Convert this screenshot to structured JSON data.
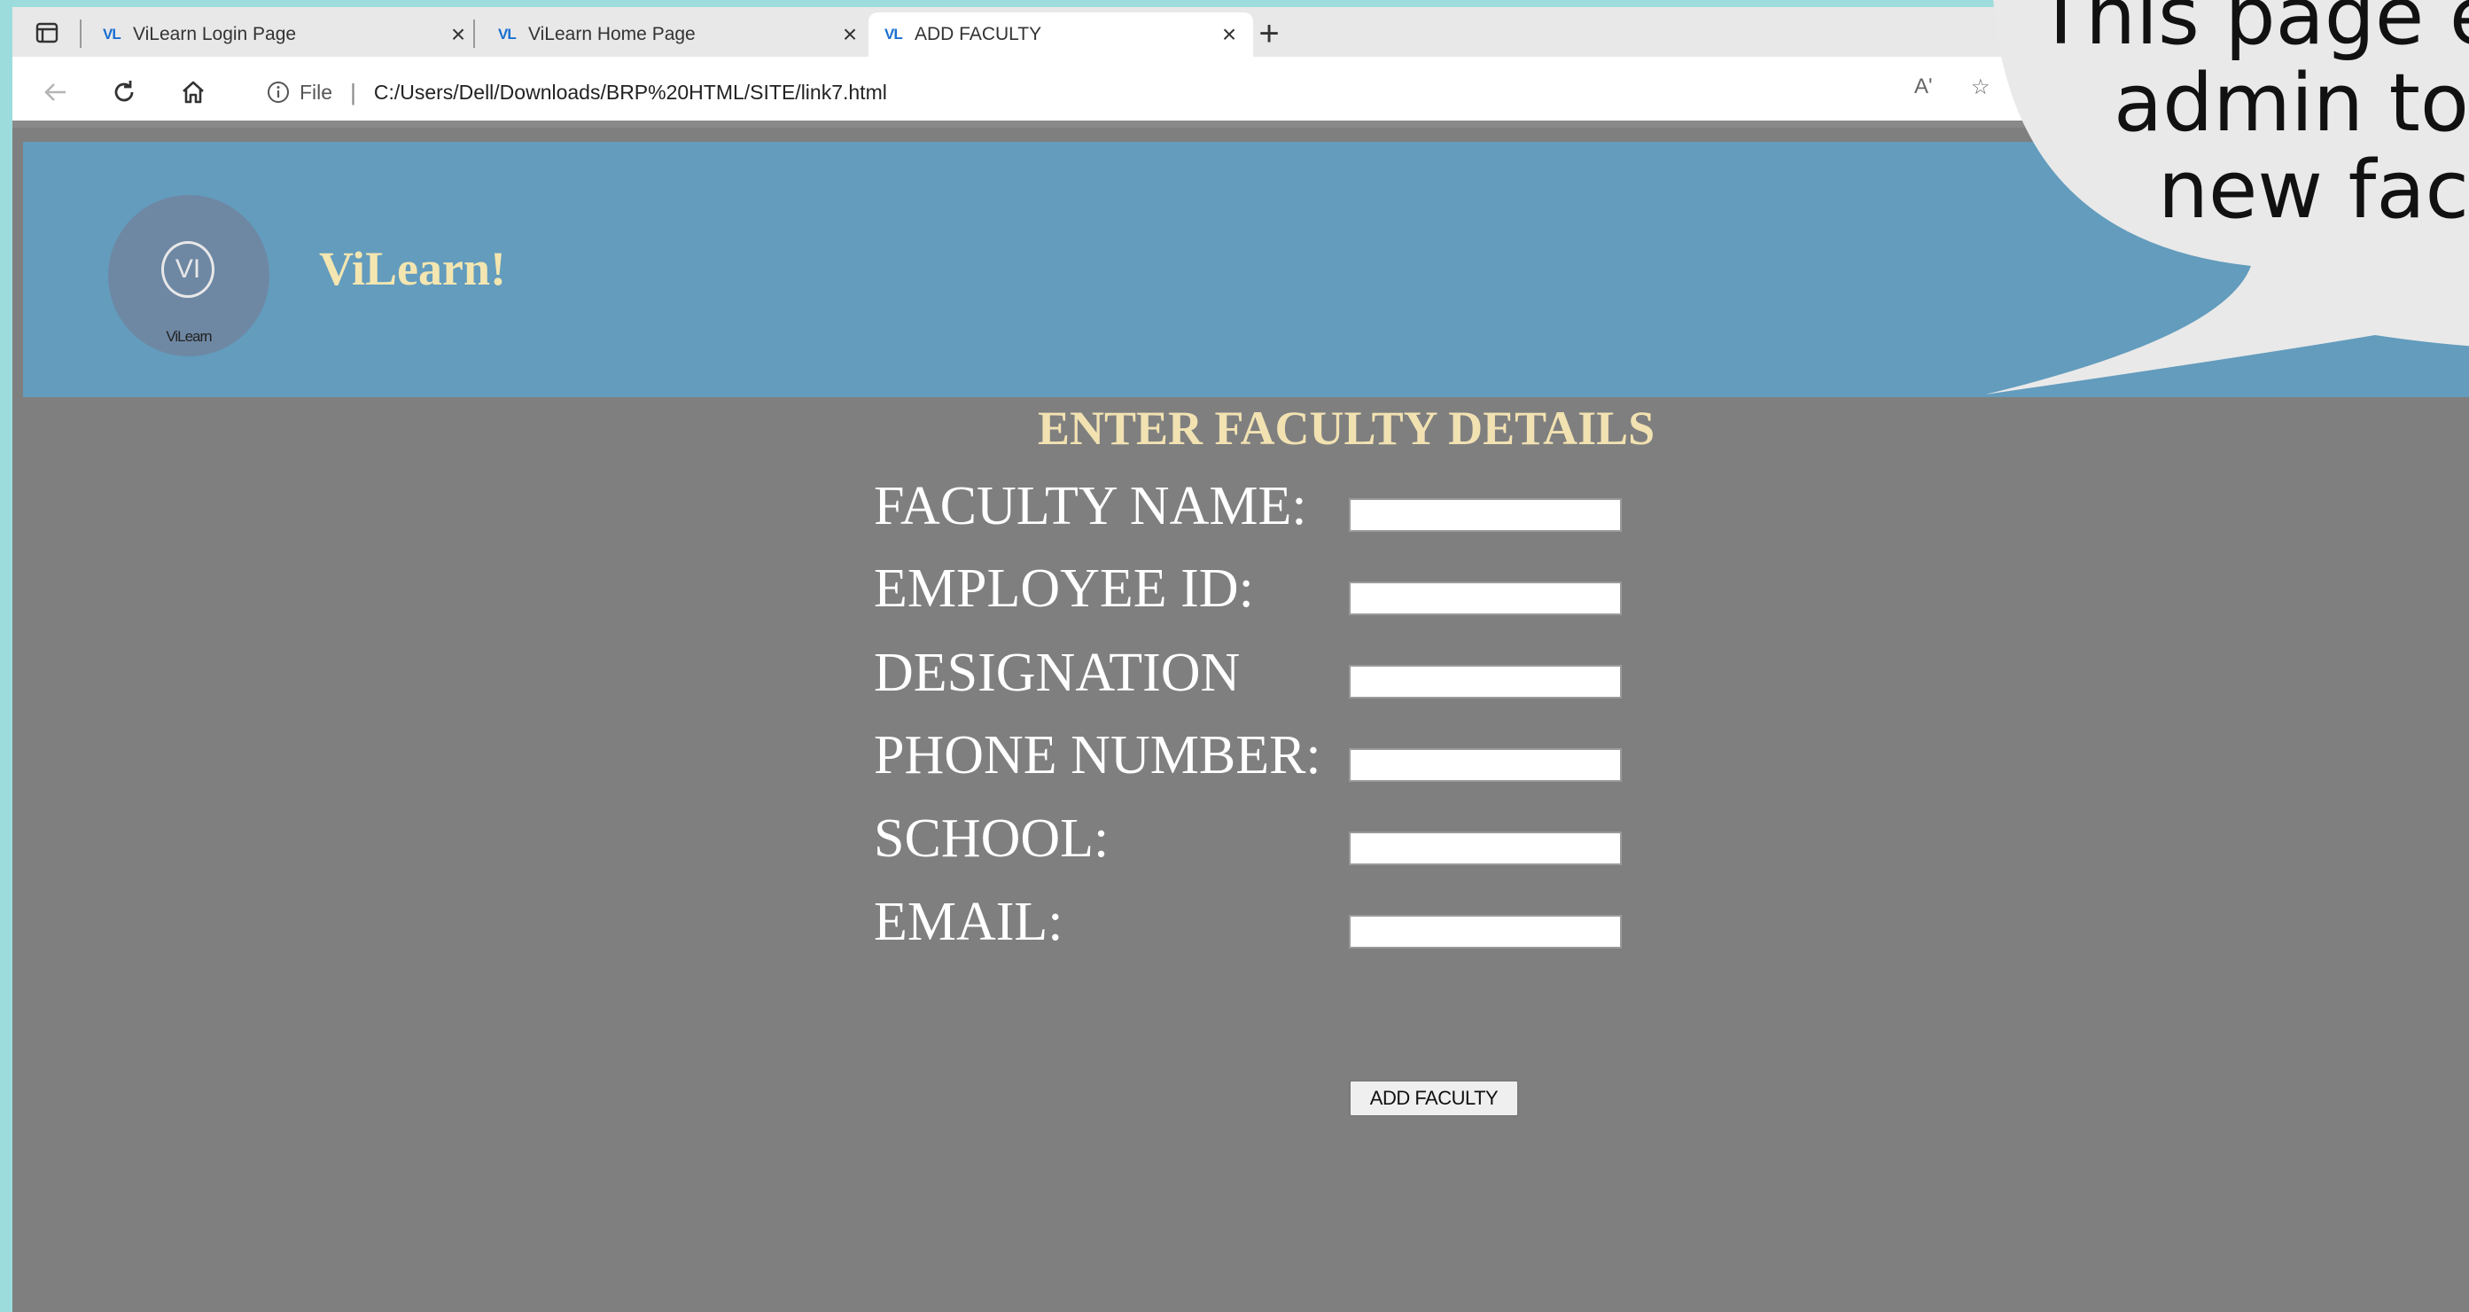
{
  "browser": {
    "tabs": [
      {
        "favicon": "VL",
        "title": "ViLearn Login Page",
        "active": false
      },
      {
        "favicon": "VL",
        "title": "ViLearn Home Page",
        "active": false
      },
      {
        "favicon": "VL",
        "title": "ADD FACULTY",
        "active": true
      }
    ],
    "new_tab": "+",
    "close_glyph": "×",
    "file_label": "File",
    "separator": "|",
    "url": "C:/Users/Dell/Downloads/BRP%20HTML/SITE/link7.html",
    "read_aloud": "Aʹ",
    "favorite_fragment": "☆"
  },
  "header": {
    "logo_mark": "VI",
    "logo_caption": "ViLearn",
    "brand": "ViLearn!",
    "color": "#639cbd"
  },
  "form": {
    "title": "ENTER FACULTY DETAILS",
    "fields": [
      {
        "label": "FACULTY NAME:",
        "value": ""
      },
      {
        "label": "EMPLOYEE ID:",
        "value": ""
      },
      {
        "label": "DESIGNATION",
        "value": ""
      },
      {
        "label": "PHONE NUMBER:",
        "value": ""
      },
      {
        "label": "SCHOOL:",
        "value": ""
      },
      {
        "label": "EMAIL:",
        "value": ""
      }
    ],
    "submit_label": "ADD FACULTY"
  },
  "annotation": {
    "lines": [
      "This page en",
      "admin to a",
      "new facu"
    ]
  }
}
